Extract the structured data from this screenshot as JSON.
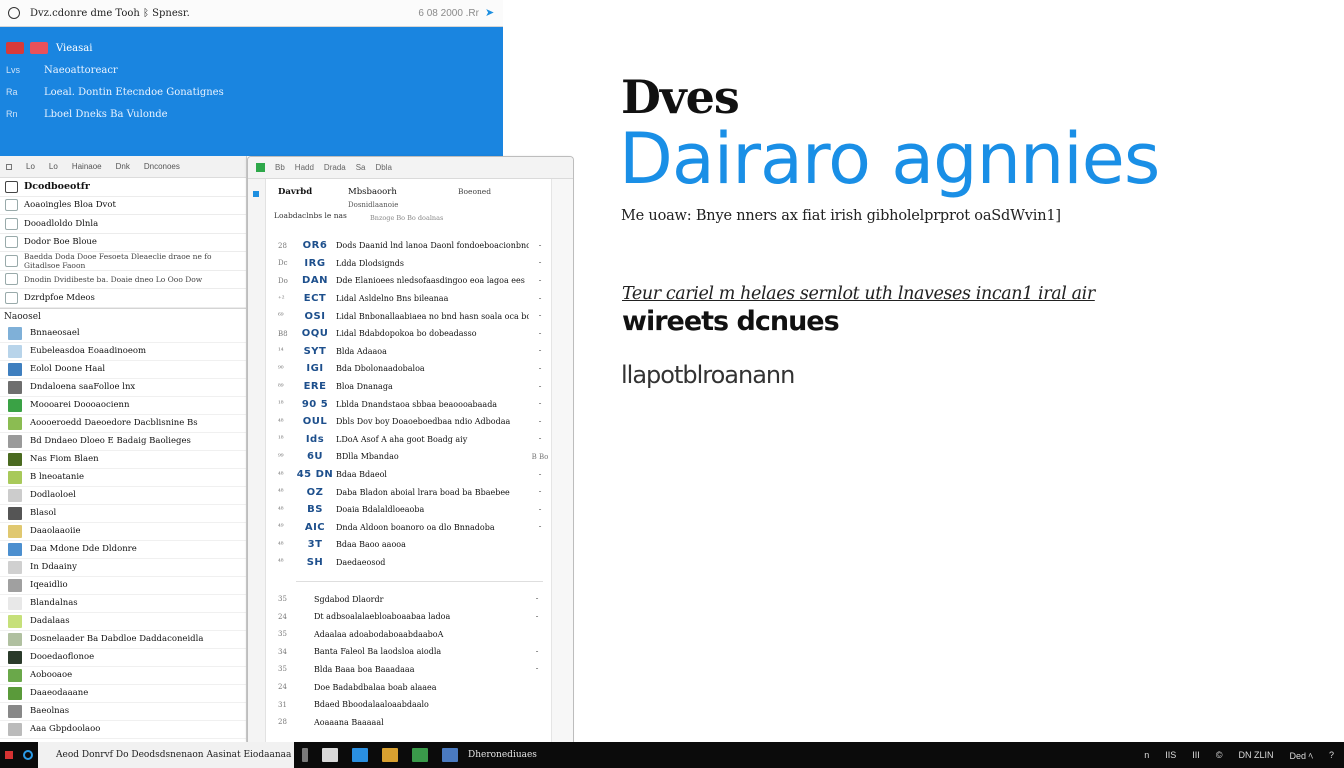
{
  "top_window": {
    "title": "Dvz.cdonre dme Tooh ᛒ Spnesr.",
    "meta": "6 08 2000 .Rr",
    "rows": [
      {
        "lead": "",
        "text": "Vieasai"
      },
      {
        "lead": "Lvs",
        "text": "Naeoattoreacr"
      },
      {
        "lead": "Ra",
        "text": "Loeal. Dontin Etecndoe Gonatignes"
      },
      {
        "lead": "Rn",
        "text": "Lboel Dneks Ba Vulonde"
      }
    ]
  },
  "left_panel": {
    "toolbar": [
      "Lo",
      "Lo",
      "Hainaoe",
      "Dnk",
      "Dnconoes"
    ],
    "upper_rows": [
      {
        "label": "Dcodboeotfr",
        "kind": "head"
      },
      {
        "label": "Aoaoingles Bloa Dvot",
        "kind": "normal"
      },
      {
        "label": "Dooadloldo Dlnla",
        "kind": "normal"
      },
      {
        "label": "Dodor Boe Bloue",
        "kind": "normal"
      },
      {
        "label": "Baedda Doda Dooe Fesoeta Dleaeclie draoe ne fo Gitadlsoe Faoon",
        "kind": "small"
      },
      {
        "label": "Dnodin Dvidibeste ba. Doaie dneo Lo Ooo Dow",
        "kind": "small"
      },
      {
        "label": "Dzrdpfoe Mdeos",
        "kind": "normal"
      }
    ],
    "section_label": "Naoosel",
    "items": [
      {
        "label": "Bnnaeosael",
        "color": "#7fb0d8"
      },
      {
        "label": "Eubeleasdoa Eoaadinoeom",
        "color": "#b8d4ea"
      },
      {
        "label": "Eolol Doone Haal",
        "color": "#3f7fbf"
      },
      {
        "label": "Dndaloena saaFolloe lnx",
        "color": "#6e6e6e"
      },
      {
        "label": "Moooarei Doooaocienn",
        "color": "#3aa245"
      },
      {
        "label": "Aoooeroedd Daeoedore Dacblisnine Bs",
        "color": "#8bbc52"
      },
      {
        "label": "Bd Dndaeo Dloeo E Badaig Baolieges",
        "color": "#9a9a9a"
      },
      {
        "label": "Nas Fiom Blaen",
        "color": "#4a6a20"
      },
      {
        "label": "B lneoatanie",
        "color": "#a8c95a"
      },
      {
        "label": "Dodlaoloel",
        "color": "#cccccc"
      },
      {
        "label": "Blasol",
        "color": "#555555"
      },
      {
        "label": "Daaolaaoiie",
        "color": "#e0c870"
      },
      {
        "label": "Daa Mdone Dde Dldonre",
        "color": "#4c8fcf"
      },
      {
        "label": "In Ddaainy",
        "color": "#d0d0d0"
      },
      {
        "label": "Iqeaidlio",
        "color": "#a0a0a0"
      },
      {
        "label": "Blandalnas",
        "color": "#e8e8e8"
      },
      {
        "label": "Dadalaas",
        "color": "#c6e07a"
      },
      {
        "label": "Dosnelaader Ba Dabdloe Daddaconeidla",
        "color": "#b0c0a0"
      },
      {
        "label": "Dooedaoflonoe",
        "color": "#2a3a2a"
      },
      {
        "label": "Aobooaoe",
        "color": "#6aa84a"
      },
      {
        "label": "Daaeodaaane",
        "color": "#5a9a3a"
      },
      {
        "label": "Baeolnas",
        "color": "#888888"
      },
      {
        "label": "Aaa Gbpdoolaoo",
        "color": "#bbbbbb"
      }
    ]
  },
  "mid_panel": {
    "toolbar": [
      "Bb",
      "Hadd",
      "Drada",
      "Sa",
      "Dbla"
    ],
    "header": {
      "col1": "Davrbd",
      "col2": "Mbsbaoorh",
      "col3": "Boeoned",
      "sub2": "Dosnidlaanoie",
      "row_label": "Loabdaclnbs le nas",
      "row_sub": "Bnzoge Bo  Bo  doalnas"
    },
    "rows": [
      {
        "gut": "28",
        "code": "OR6",
        "desc": "Dods  Daanid lnd lanoa Daonl fondoeboacionbnoe",
        "rm": "⁃"
      },
      {
        "gut": "Dc",
        "code": "IRG",
        "desc": "Ldda  Dlodsignds",
        "rm": "⁃"
      },
      {
        "gut": "Do",
        "code": "DAN",
        "desc": "Dde  Elanioees nledsofaasdingoo eoa lagoa ees",
        "rm": "⁃"
      },
      {
        "gut": "⁺²",
        "code": "ECT",
        "desc": "Lidal  Asldelno Bns bileanaa",
        "rm": "⁃"
      },
      {
        "gut": "⁶⁹",
        "code": "OSI",
        "desc": "Lidal  Bnbonallaabiaea no bnd hasn soala oca bo",
        "rm": "⁃"
      },
      {
        "gut": "B8",
        "code": "OQU",
        "desc": "Lidal  Bdabdopokoa bo dobeadasso",
        "rm": "⁃"
      },
      {
        "gut": "¹⁴",
        "code": "SYT",
        "desc": "Blda  Adaaoa",
        "rm": "⁃"
      },
      {
        "gut": "⁹⁰",
        "code": "IGI",
        "desc": "Bda  Dbolonaadobaloa",
        "rm": "⁃"
      },
      {
        "gut": "⁸⁹",
        "code": "ERE",
        "desc": "Bloa  Dnanaga",
        "rm": "⁃"
      },
      {
        "gut": "¹⁸",
        "code": "90 5",
        "desc": "Lblda  Dnandstaoa sbbaa beaoooabaada",
        "rm": "⁃"
      },
      {
        "gut": "⁴⁸",
        "code": "OUL",
        "desc": "Dbls  Dov boy Doaoeboedbaa ndio Adbodaa",
        "rm": "⁃"
      },
      {
        "gut": "¹⁸",
        "code": "Ids",
        "desc": "LDoA  Asof A aha goot Boadg aiy",
        "rm": "⁃"
      },
      {
        "gut": "⁹⁹",
        "code": "6U",
        "desc": "BDlla  Mbandao",
        "rm": "B  Bo"
      },
      {
        "gut": "⁴⁸",
        "code": "45 DN",
        "desc": "Bdaa  Bdaeol",
        "rm": "⁃"
      },
      {
        "gut": "⁴⁸",
        "code": "OZ",
        "desc": "Daba  Bladon aboial  lrara boad ba Bbaebee",
        "rm": "⁃"
      },
      {
        "gut": "⁴⁸",
        "code": "BS",
        "desc": "Doaia  Bdalaldloeaoba",
        "rm": "⁃"
      },
      {
        "gut": "⁴⁹",
        "code": "AIC",
        "desc": "Dnda  Aldoon boanoro oa dlo Bnnadoba",
        "rm": "⁃"
      },
      {
        "gut": "⁴⁸",
        "code": "3T",
        "desc": "Bdaa  Baoo aaooa",
        "rm": ""
      },
      {
        "gut": "⁴⁸",
        "code": "SH",
        "desc": "Daedaeosod",
        "rm": ""
      }
    ],
    "rows2": [
      {
        "gut": "35",
        "desc": "Sgdabod Dlaordr",
        "rm": "⁃"
      },
      {
        "gut": "24",
        "desc": "Dt adbsoalalaebloaboaabaa ladoa",
        "rm": "⁃"
      },
      {
        "gut": "35",
        "desc": "Adaalaa adoabodaboaabdaaboA",
        "rm": ""
      },
      {
        "gut": "34",
        "desc": "Banta Faleol Ba laodsloa aiodla",
        "rm": "⁃"
      },
      {
        "gut": "35",
        "desc": "Blda Baaa boa Baaadaaa",
        "rm": "⁃"
      },
      {
        "gut": "24",
        "desc": "Doe Badabdbalaa boab alaaea",
        "rm": ""
      },
      {
        "gut": "31",
        "desc": "Bdaed Bboodalaaloaabdaalo",
        "rm": ""
      },
      {
        "gut": "28",
        "desc": "Aoaaana  Baaaaal",
        "rm": ""
      }
    ]
  },
  "hero": {
    "small": "Dves",
    "big": "Dairaro agnnies",
    "subtitle": "Me uoaw: Bnye nners ax fiat irish gibholelprprot oaSdWvin1]",
    "link": "Teur cariel m helaes sernlot uth lnaveses incan1 iral air",
    "bold": "wireets dcnues",
    "foot": "llapotblroanann"
  },
  "taskbar": {
    "search_text": "Aeod Donrvf  Do Deodsdsnenaon Aasinat Eiodaanaa Rotand)",
    "label": "Dheronediuaes",
    "tray": [
      "n",
      "IIS",
      "III",
      "©",
      "DN  ZLIN",
      "Ded  ﾍ",
      "?"
    ],
    "app_colors": [
      "#7a7a7a",
      "#d9d9d9",
      "#2a8fe0",
      "#d8a030",
      "#3a9a4a",
      "#4a7ac0"
    ]
  }
}
